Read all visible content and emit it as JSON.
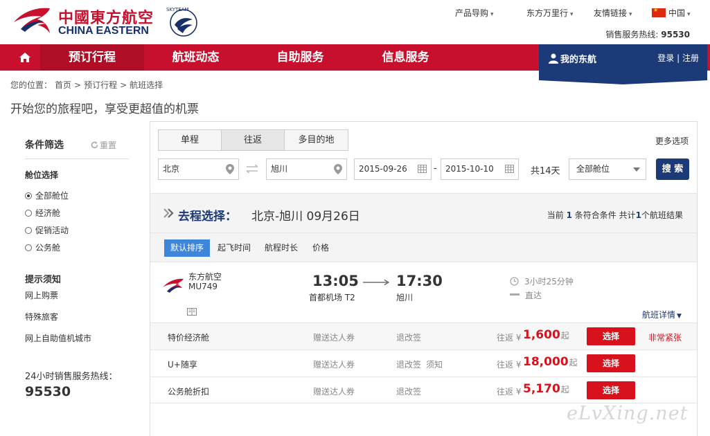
{
  "brand": {
    "name_cn": "中國東方航空",
    "name_en": "CHINA EASTERN",
    "alliance": "SKYTEAM",
    "primary_color": "#c8102e",
    "navy_color": "#1c3a78"
  },
  "top_nav": {
    "products": "产品导购",
    "miles": "东方万里行",
    "links": "友情链接",
    "region": "中国",
    "hotline_label": "销售服务热线:",
    "hotline_number": "95530"
  },
  "main_nav": {
    "items": [
      {
        "label": "预订行程"
      },
      {
        "label": "航班动态"
      },
      {
        "label": "自助服务"
      },
      {
        "label": "信息服务"
      }
    ],
    "my_account": "我的东航",
    "login": "登录",
    "separator": "|",
    "register": "注册"
  },
  "breadcrumb": {
    "prefix": "您的位置：",
    "items": [
      "首页",
      "预订行程",
      "航班选择"
    ],
    "sep": ">"
  },
  "slogan": "开始您的旅程吧，享受更超值的机票",
  "sidebar": {
    "filter_title": "条件筛选",
    "reset": "重置",
    "cabin_title": "舱位选择",
    "cabin_options": [
      "全部舱位",
      "经济舱",
      "促销活动",
      "公务舱"
    ],
    "cabin_selected": 0,
    "tips_title": "提示须知",
    "tips_links": [
      "网上购票",
      "特殊旅客",
      "网上自助值机城市"
    ],
    "hotline_label": "24小时销售服务热线：",
    "hotline_number": "95530"
  },
  "search": {
    "trip_types": [
      "单程",
      "往返",
      "多目的地"
    ],
    "trip_selected": 1,
    "more_options": "更多选项",
    "from": "北京",
    "to": "旭川",
    "depart_date": "2015-09-26",
    "return_date": "2015-10-10",
    "date_sep": "-",
    "days": "共14天",
    "cabin": "全部舱位",
    "search_btn": "搜 索"
  },
  "route": {
    "label": "去程选择：",
    "text": "北京-旭川  09月26日",
    "count_prefix": "当前",
    "count_current": "1",
    "count_mid": "条符合条件 共计",
    "count_total": "1",
    "count_suffix": "个航班结果"
  },
  "sort": {
    "items": [
      "默认排序",
      "起飞时间",
      "航程时长",
      "价格"
    ]
  },
  "flight": {
    "airline": "东方航空",
    "number": "MU749",
    "dep_time": "13:05",
    "dep_airport": "首都机场 T2",
    "arr_time": "17:30",
    "arr_airport": "旭川",
    "duration": "3小时25分钟",
    "stops": "直达",
    "detail_link": "航班详情"
  },
  "fares": [
    {
      "name": "特价经济舱",
      "gift": "赠送达人券",
      "change": "退改签",
      "notice": "",
      "roundtrip": "往返 ¥",
      "price": "1,600",
      "from": "起",
      "button": "选择",
      "tag": "非常紧张"
    },
    {
      "name": "U+随享",
      "gift": "赠送达人券",
      "change": "退改签",
      "notice": "须知",
      "roundtrip": "往返 ¥",
      "price": "18,000",
      "from": "起",
      "button": "选择",
      "tag": ""
    },
    {
      "name": "公务舱折扣",
      "gift": "赠送达人券",
      "change": "退改签",
      "notice": "",
      "roundtrip": "往返 ¥",
      "price": "5,170",
      "from": "起",
      "button": "选择",
      "tag": ""
    }
  ],
  "watermark": "eLvXing.net"
}
